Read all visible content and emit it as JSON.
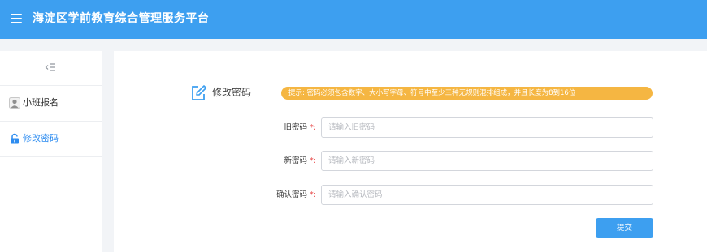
{
  "header": {
    "title": "海淀区学前教育综合管理服务平台",
    "background_color": "#3d9ff0",
    "menu_icon": "hamburger-menu-icon"
  },
  "sidebar": {
    "collapse_icon": "collapse-menu-icon",
    "items": [
      {
        "label": "小班报名",
        "icon": "user-icon",
        "active": false
      },
      {
        "label": "修改密码",
        "icon": "lock-icon",
        "active": true
      }
    ],
    "active_color": "#2d8cf0"
  },
  "main": {
    "section_title": "修改密码",
    "section_icon": "edit-icon",
    "tip": "提示: 密码必须包含数字、大小写字母、符号中至少三种无规则混排组成，并且长度为8到16位",
    "tip_color": "#f5b642",
    "form": {
      "old_password": {
        "label": "旧密码",
        "required_mark": "*:",
        "placeholder": "请输入旧密码",
        "value": ""
      },
      "new_password": {
        "label": "新密码",
        "required_mark": "*:",
        "placeholder": "请输入新密码",
        "value": ""
      },
      "confirm_password": {
        "label": "确认密码",
        "required_mark": "*:",
        "placeholder": "请输入确认密码",
        "value": ""
      }
    },
    "submit_label": "提交"
  }
}
